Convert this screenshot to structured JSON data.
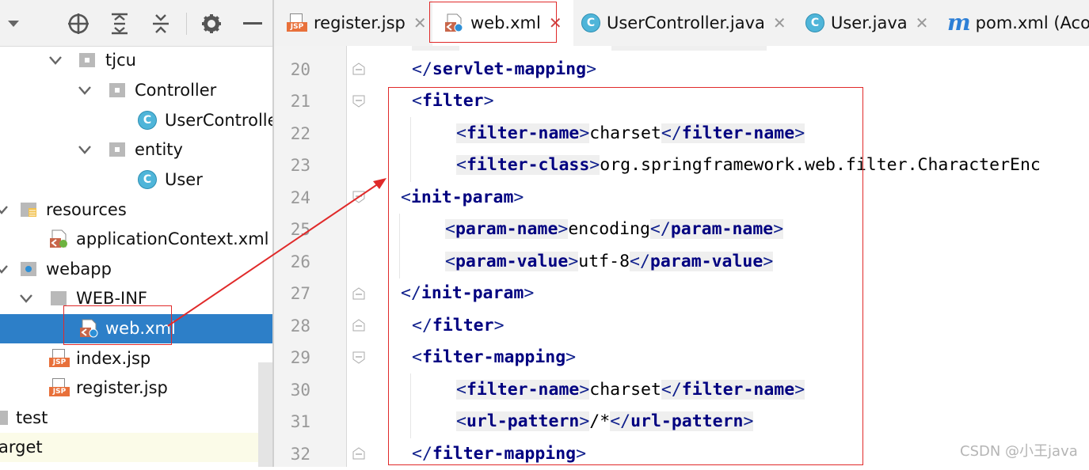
{
  "project_tree": {
    "items": [
      {
        "label": "tjcu"
      },
      {
        "label": "Controller"
      },
      {
        "label": "UserControlle"
      },
      {
        "label": "entity"
      },
      {
        "label": "User"
      },
      {
        "label": "resources"
      },
      {
        "label": "applicationContext.xml"
      },
      {
        "label": "webapp"
      },
      {
        "label": "WEB-INF"
      },
      {
        "label": "web.xml"
      },
      {
        "label": "index.jsp"
      },
      {
        "label": "register.jsp"
      },
      {
        "label": "test"
      },
      {
        "label": "arget"
      }
    ]
  },
  "tabs": [
    {
      "label": "register.jsp",
      "icon": "jsp-file-icon"
    },
    {
      "label": "web.xml",
      "icon": "web-xml-file-icon",
      "active": true
    },
    {
      "label": "UserController.java",
      "icon": "class-icon"
    },
    {
      "label": "User.java",
      "icon": "class-icon"
    },
    {
      "label": "pom.xml (Acou",
      "icon": "maven-icon",
      "icon_glyph": "m"
    }
  ],
  "icon_labels": {
    "class_glyph": "C",
    "jsp_tag": "JSP"
  },
  "editor": {
    "lines": [
      {
        "n": "20",
        "tag": "servlet-mapping",
        "close": true
      },
      {
        "n": "21",
        "tag": "filter",
        "close": false
      },
      {
        "n": "22",
        "tag": "filter-name",
        "value": "charset"
      },
      {
        "n": "23",
        "tag": "filter-class",
        "value": "org.springframework.web.filter.CharacterEnc"
      },
      {
        "n": "24",
        "tag": "init-param",
        "close": false
      },
      {
        "n": "25",
        "tag": "param-name",
        "value": "encoding"
      },
      {
        "n": "26",
        "tag": "param-value",
        "value": "utf-8"
      },
      {
        "n": "27",
        "tag": "init-param",
        "close": true
      },
      {
        "n": "28",
        "tag": "filter",
        "close": true
      },
      {
        "n": "29",
        "tag": "filter-mapping",
        "close": false
      },
      {
        "n": "30",
        "tag": "filter-name",
        "value": "charset"
      },
      {
        "n": "31",
        "tag": "url-pattern",
        "value": "/*"
      },
      {
        "n": "32",
        "tag": "filter-mapping",
        "close": true
      }
    ]
  },
  "watermark": "CSDN @小王java",
  "colors": {
    "selection": "#2d7fc8",
    "annotation_red": "#e02a2a",
    "xml_tag": "#000080",
    "class_icon": "#4fb5d9",
    "jsp_badge": "#e8703a"
  }
}
